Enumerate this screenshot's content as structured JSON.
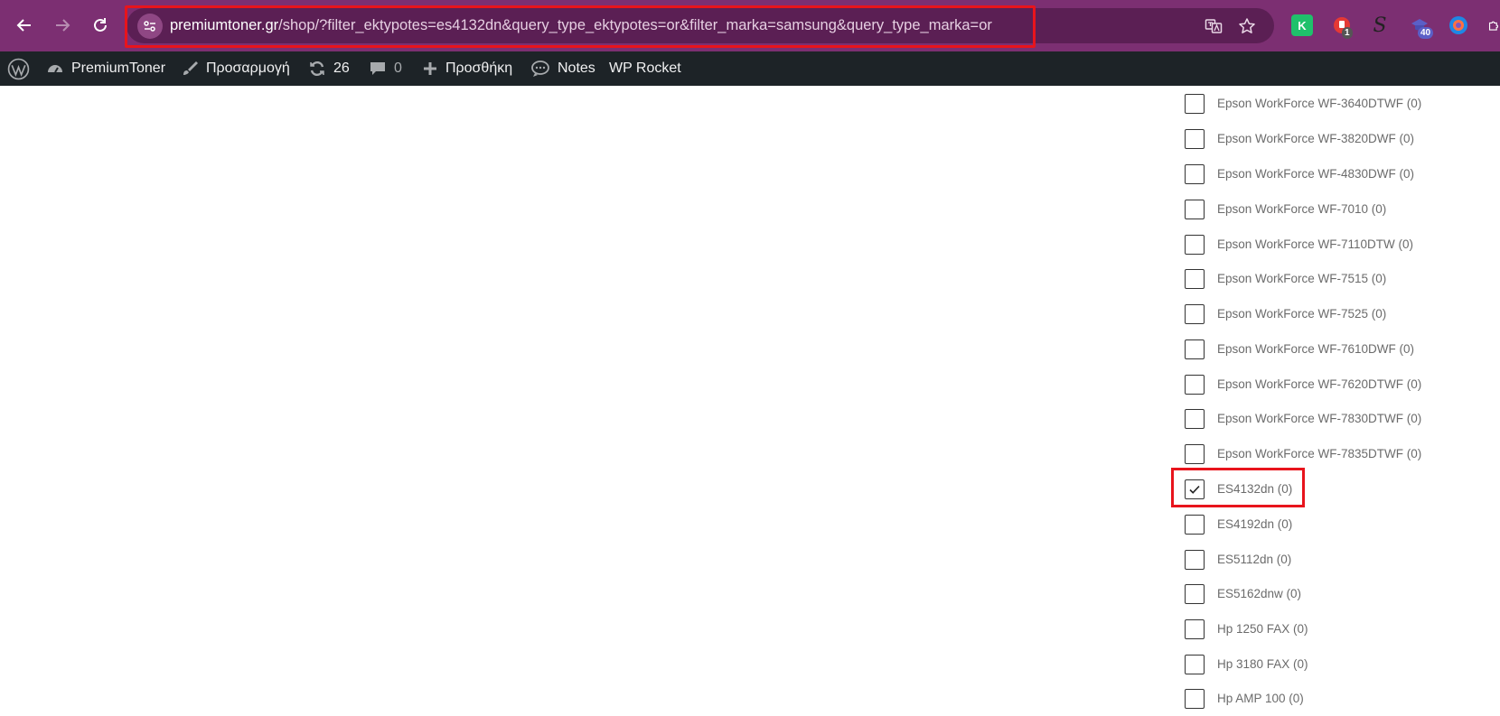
{
  "browser": {
    "url_host": "premiumtoner.gr",
    "url_path": "/shop/?filter_ektypotes=es4132dn&query_type_ektypotes=or&filter_marka=samsung&query_type_marka=or",
    "extensions": [
      {
        "name": "k-extension-icon",
        "label": "K",
        "color": "#1fc16b"
      },
      {
        "name": "badge-extension-icon",
        "label": "",
        "badge": "1",
        "color": "#e53935"
      },
      {
        "name": "s-extension-icon",
        "label": "S",
        "color": "#222222"
      },
      {
        "name": "cap-extension-icon",
        "label": "",
        "badge": "40",
        "color": "#5b5fc7"
      },
      {
        "name": "firefox-relay-icon",
        "label": "",
        "color": "#1e88e5"
      }
    ]
  },
  "adminbar": {
    "site_name": "PremiumToner",
    "customize": "Προσαρμογή",
    "updates_count": "26",
    "comments_count": "0",
    "new_label": "Προσθήκη",
    "notes_label": "Notes",
    "wprocket_label": "WP Rocket"
  },
  "filters": [
    {
      "label": "Epson WorkForce WF-3640DTWF (0)",
      "checked": false
    },
    {
      "label": "Epson WorkForce WF-3820DWF (0)",
      "checked": false
    },
    {
      "label": "Epson WorkForce WF-4830DWF (0)",
      "checked": false
    },
    {
      "label": "Epson WorkForce WF-7010 (0)",
      "checked": false
    },
    {
      "label": "Epson WorkForce WF-7110DTW (0)",
      "checked": false
    },
    {
      "label": "Epson WorkForce WF-7515 (0)",
      "checked": false
    },
    {
      "label": "Epson WorkForce WF-7525 (0)",
      "checked": false
    },
    {
      "label": "Epson WorkForce WF-7610DWF (0)",
      "checked": false
    },
    {
      "label": "Epson WorkForce WF-7620DTWF (0)",
      "checked": false
    },
    {
      "label": "Epson WorkForce WF-7830DTWF (0)",
      "checked": false
    },
    {
      "label": "Epson WorkForce WF-7835DTWF (0)",
      "checked": false
    },
    {
      "label": "ES4132dn (0)",
      "checked": true
    },
    {
      "label": "ES4192dn (0)",
      "checked": false
    },
    {
      "label": "ES5112dn (0)",
      "checked": false
    },
    {
      "label": "ES5162dnw (0)",
      "checked": false
    },
    {
      "label": "Hp 1250 FAX (0)",
      "checked": false
    },
    {
      "label": "Hp 3180 FAX (0)",
      "checked": false
    },
    {
      "label": "Hp AMP 100 (0)",
      "checked": false
    }
  ],
  "colors": {
    "chrome_bg": "#7c2f72",
    "adminbar_bg": "#1d2327",
    "highlight": "#e8141c"
  }
}
